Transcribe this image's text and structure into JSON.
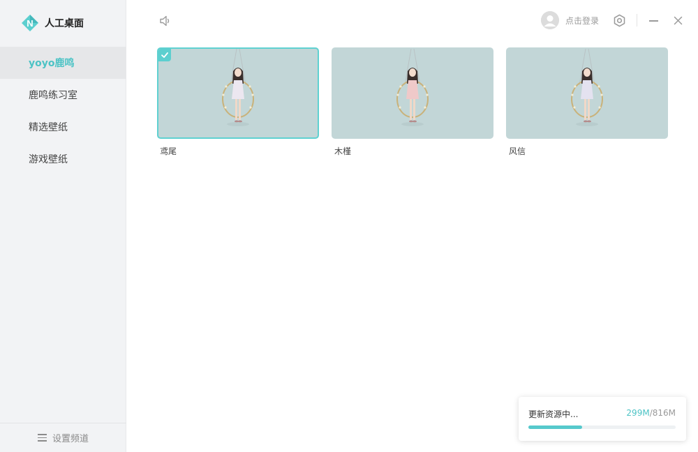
{
  "app": {
    "name": "人工桌面"
  },
  "sidebar": {
    "items": [
      {
        "label": "yoyo鹿鸣",
        "active": true
      },
      {
        "label": "鹿鸣练习室",
        "active": false
      },
      {
        "label": "精选壁纸",
        "active": false
      },
      {
        "label": "游戏壁纸",
        "active": false
      }
    ],
    "footer_label": "设置频道"
  },
  "topbar": {
    "login_label": "点击登录"
  },
  "wallpapers": [
    {
      "name": "鸢尾",
      "selected": true,
      "outfit": "#ece7f0"
    },
    {
      "name": "木槿",
      "selected": false,
      "outfit": "#efc9c9"
    },
    {
      "name": "风信",
      "selected": false,
      "outfit": "#e4e2f0"
    }
  ],
  "download": {
    "status": "更新资源中...",
    "done": "299M",
    "total": "816M",
    "progress": 0.366
  },
  "colors": {
    "accent": "#4cc3c5",
    "thumb_bg": "#c2d6d7"
  }
}
